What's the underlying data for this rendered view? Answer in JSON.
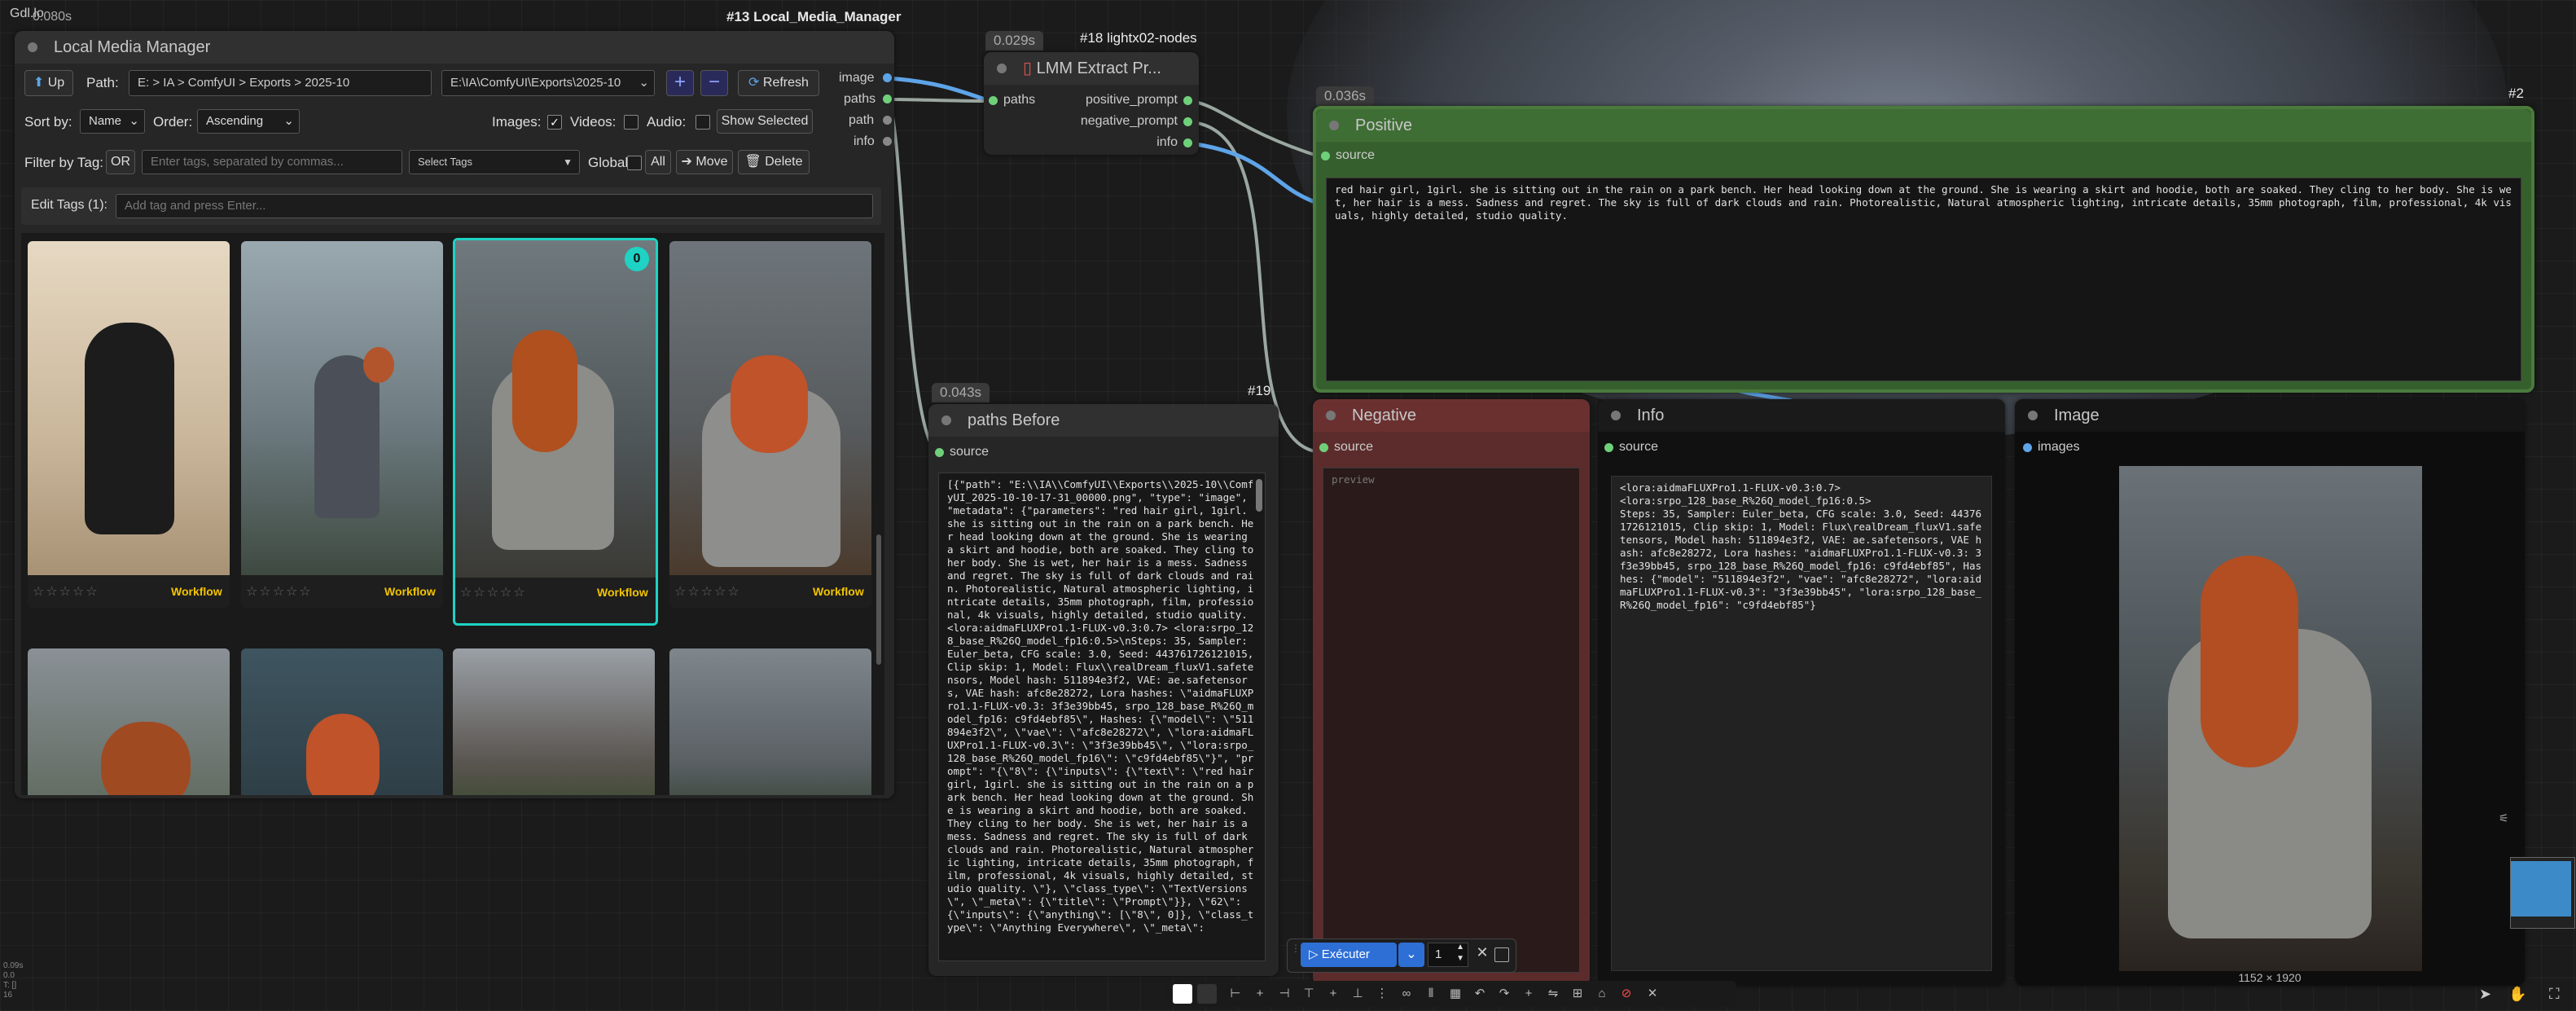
{
  "corner": {
    "title": "Gdl.lo",
    "timing": "0.080s",
    "bottom_lines": [
      "0.09s",
      "0.0",
      "T: []",
      "16"
    ]
  },
  "lmm": {
    "id_label": "#13 Local_Media_Manager",
    "title": "Local Media Manager",
    "up_label": "Up",
    "path_label": "Path:",
    "crumbs": [
      "E:",
      "IA",
      "ComfyUI",
      "Exports",
      "2025-10"
    ],
    "path_select": "E:\\IA\\ComfyUI\\Exports\\2025-10",
    "refresh_label": "Refresh",
    "sort_label": "Sort by:",
    "sort_value": "Name",
    "order_label": "Order:",
    "order_value": "Ascending",
    "images_label": "Images:",
    "videos_label": "Videos:",
    "audio_label": "Audio:",
    "show_selected": "Show Selected",
    "filter_label": "Filter by Tag:",
    "or_label": "OR",
    "tag_placeholder": "Enter tags, separated by commas...",
    "select_tags": "Select Tags",
    "global_label": "Global:",
    "all_label": "All",
    "move_label": "Move",
    "delete_label": "Delete",
    "edit_tags_label": "Edit Tags (1):",
    "edit_tags_placeholder": "Add tag and press Enter...",
    "workflow_label": "Workflow",
    "selected_badge": "0",
    "outputs": [
      "image",
      "paths",
      "path",
      "info"
    ]
  },
  "extract": {
    "badge": "0.029s",
    "id_label": "#18 lightx02-nodes",
    "title": "LMM Extract Pr...",
    "input": "paths",
    "outputs": [
      "positive_prompt",
      "negative_prompt",
      "info"
    ]
  },
  "positive": {
    "badge": "0.036s",
    "id_label": "#2",
    "title": "Positive",
    "input": "source",
    "text": "red hair girl, 1girl. she is sitting out in the rain on a park bench. Her head looking down at the ground. She is wearing a skirt and hoodie, both are soaked. They cling to her body. She is wet, her hair is a mess. Sadness and regret. The sky is full of dark clouds and rain. Photorealistic, Natural atmospheric lighting, intricate details, 35mm photograph, film, professional, 4k visuals, highly detailed, studio quality."
  },
  "paths_before": {
    "badge": "0.043s",
    "id_label": "#19",
    "title": "paths Before",
    "input": "source",
    "text": "[{\"path\": \"E:\\\\IA\\\\ComfyUI\\\\Exports\\\\2025-10\\\\ComfyUI_2025-10-10-17-31_00000.png\", \"type\": \"image\", \"metadata\": {\"parameters\": \"red hair girl, 1girl. she is sitting out in the rain on a park bench. Her head looking down at the ground. She is wearing a skirt and hoodie, both are soaked. They cling to her body. She is wet, her hair is a mess. Sadness and regret. The sky is full of dark clouds and rain. Photorealistic, Natural atmospheric lighting, intricate details, 35mm photograph, film, professional, 4k visuals, highly detailed, studio quality.  <lora:aidmaFLUXPro1.1-FLUX-v0.3:0.7> <lora:srpo_128_base_R%26Q_model_fp16:0.5>\\nSteps: 35, Sampler: Euler_beta, CFG scale: 3.0, Seed: 443761726121015, Clip skip: 1, Model: Flux\\\\realDream_fluxV1.safetensors, Model hash: 511894e3f2, VAE: ae.safetensors, VAE hash: afc8e28272, Lora hashes: \\\"aidmaFLUXPro1.1-FLUX-v0.3: 3f3e39bb45, srpo_128_base_R%26Q_model_fp16: c9fd4ebf85\\\", Hashes: {\\\"model\\\": \\\"511894e3f2\\\", \\\"vae\\\": \\\"afc8e28272\\\", \\\"lora:aidmaFLUXPro1.1-FLUX-v0.3\\\": \\\"3f3e39bb45\\\", \\\"lora:srpo_128_base_R%26Q_model_fp16\\\": \\\"c9fd4ebf85\\\"}\", \"prompt\": \"{\\\"8\\\": {\\\"inputs\\\": {\\\"text\\\": \\\"red hair girl, 1girl. she is sitting out in the rain on a park bench. Her head looking down at the ground. She is wearing a skirt and hoodie, both are soaked. They cling to her body. She is wet, her hair is a mess. Sadness and regret. The sky is full of dark clouds and rain. Photorealistic, Natural atmospheric lighting, intricate details, 35mm photograph, film, professional, 4k visuals, highly detailed, studio quality. \\\"}, \\\"class_type\\\": \\\"TextVersions\\\", \\\"_meta\\\": {\\\"title\\\": \\\"Prompt\\\"}}, \\\"62\\\": {\\\"inputs\\\": {\\\"anything\\\": [\\\"8\\\", 0]}, \\\"class_type\\\": \\\"Anything Everywhere\\\", \\\"_meta\\\":"
  },
  "negative": {
    "title": "Negative",
    "input": "source",
    "placeholder": "preview"
  },
  "info": {
    "title": "Info",
    "input": "source",
    "text": "<lora:aidmaFLUXPro1.1-FLUX-v0.3:0.7>\n<lora:srpo_128_base_R%26Q_model_fp16:0.5>\nSteps: 35, Sampler: Euler_beta, CFG scale: 3.0, Seed: 443761726121015, Clip skip: 1, Model: Flux\\realDream_fluxV1.safetensors, Model hash: 511894e3f2, VAE: ae.safetensors, VAE hash: afc8e28272, Lora hashes: \"aidmaFLUXPro1.1-FLUX-v0.3: 3f3e39bb45, srpo_128_base_R%26Q_model_fp16: c9fd4ebf85\", Hashes: {\"model\": \"511894e3f2\", \"vae\": \"afc8e28272\", \"lora:aidmaFLUXPro1.1-FLUX-v0.3\": \"3f3e39bb45\", \"lora:srpo_128_base_R%26Q_model_fp16\": \"c9fd4ebf85\"}"
  },
  "image_node": {
    "title": "Image",
    "input": "images",
    "size": "1152 × 1920"
  },
  "runbar": {
    "run_label": "Exécuter",
    "count": "1"
  },
  "colors": {
    "accent": "#1ed3c4",
    "positive_bg": "#365f2e",
    "negative_bg": "#5c2c2c",
    "run_blue": "#2e6fd6",
    "workflow": "#f2c400"
  }
}
